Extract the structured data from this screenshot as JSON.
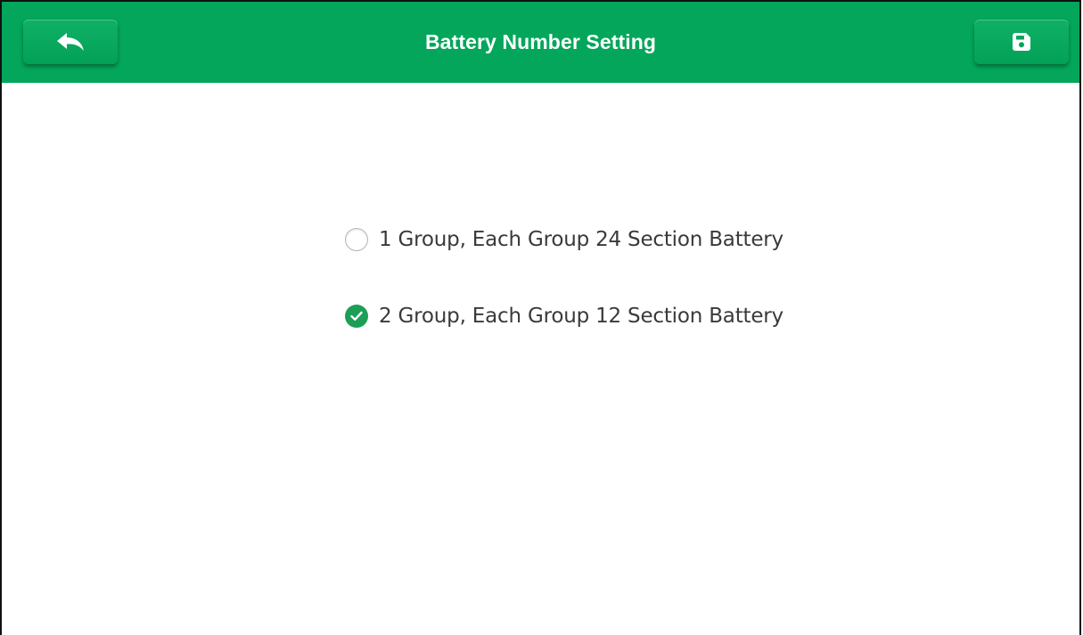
{
  "header": {
    "title": "Battery Number Setting",
    "background_color": "#03a65a",
    "back_icon": "back-arrow-icon",
    "save_icon": "save-floppy-icon"
  },
  "options": [
    {
      "label": "1 Group, Each Group 24 Section Battery",
      "selected": false
    },
    {
      "label": "2 Group, Each Group 12 Section Battery",
      "selected": true
    }
  ],
  "accent_color": "#1d9e56"
}
